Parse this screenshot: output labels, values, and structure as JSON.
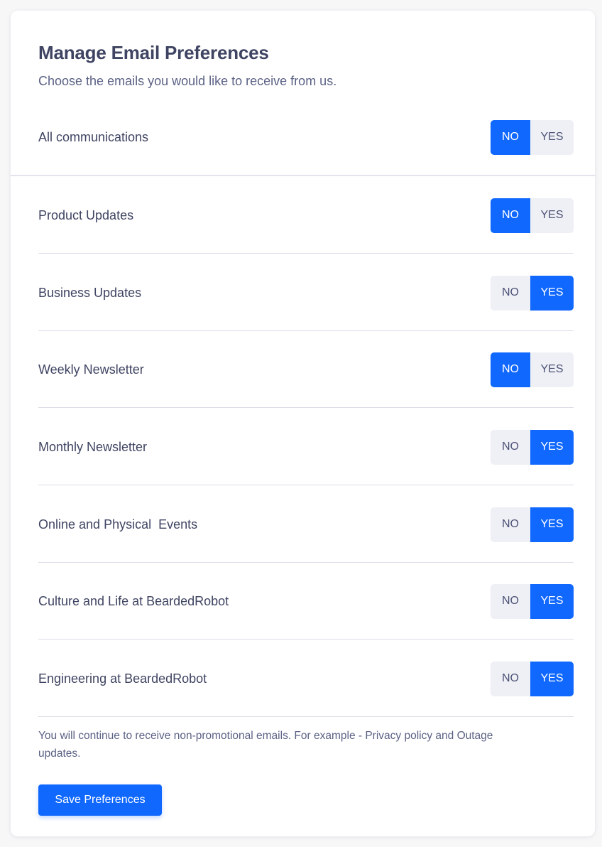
{
  "header": {
    "title": "Manage Email Preferences",
    "subtitle": "Choose the emails you would like to receive from us."
  },
  "toggle_labels": {
    "no": "NO",
    "yes": "YES"
  },
  "master": {
    "label": "All communications",
    "value": "NO"
  },
  "preferences": [
    {
      "label": "Product Updates",
      "value": "NO"
    },
    {
      "label": "Business Updates",
      "value": "YES"
    },
    {
      "label": "Weekly Newsletter",
      "value": "NO"
    },
    {
      "label": "Monthly Newsletter",
      "value": "YES"
    },
    {
      "label": "Online and Physical  Events",
      "value": "YES"
    },
    {
      "label": "Culture and Life at BeardedRobot",
      "value": "YES"
    },
    {
      "label": "Engineering at BeardedRobot",
      "value": "YES"
    }
  ],
  "footer": {
    "note": "You will continue to receive non-promotional emails. For example - Privacy policy and Outage updates.",
    "save_label": "Save Preferences"
  },
  "colors": {
    "accent": "#1068fe",
    "inactive_bg": "#eff0f5",
    "text": "#3f4462",
    "muted_text": "#5b6184"
  }
}
